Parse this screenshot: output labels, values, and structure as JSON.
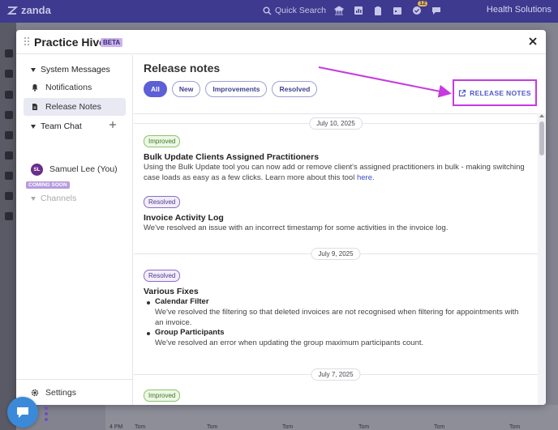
{
  "topbar": {
    "logo_text": "zanda",
    "search_placeholder": "Quick Search",
    "notification_count": "12",
    "account_name": "Health Solutions",
    "bg_color": "#3d3a8f"
  },
  "modal": {
    "title": "Practice Hive",
    "beta_label": "BETA",
    "close_icon": "close-icon"
  },
  "sidebar": {
    "system_messages": "System Messages",
    "notifications": "Notifications",
    "release_notes": "Release Notes",
    "team_chat": "Team Chat",
    "user_initials": "SL",
    "user_name": "Samuel Lee (You)",
    "coming_soon": "COMING SOON",
    "channels": "Channels",
    "settings": "Settings"
  },
  "content": {
    "title": "Release notes",
    "filters": [
      "All",
      "New",
      "Improvements",
      "Resolved"
    ],
    "active_filter": "All",
    "release_notes_button": "RELEASE NOTES",
    "accent_color": "#5c5fd6",
    "highlight_color": "#c63ae0"
  },
  "feed": [
    {
      "date": "July 10, 2025",
      "entries": [
        {
          "tag": "Improved",
          "title": "Bulk Update Clients Assigned Practitioners",
          "body_line1": "Using the Bulk Update tool you can now add or remove client's assigned practitioners in bulk - making switching",
          "body_line2": "case loads as easy as a few clicks. Learn more about this tool ",
          "link": "here",
          "link_suffix": "."
        },
        {
          "tag": "Resolved",
          "title": "Invoice Activity Log",
          "body": "We've resolved an issue with an incorrect timestamp for some activities in the invoice log."
        }
      ]
    },
    {
      "date": "July 9, 2025",
      "entries": [
        {
          "tag": "Resolved",
          "title": "Various Fixes",
          "items": [
            {
              "heading": "Calendar Filter",
              "text_line1": "We've resolved the filtering so that deleted invoices are not recognised when filtering for appointments with",
              "text_line2": "an invoice."
            },
            {
              "heading": "Group Participants",
              "text_line1": "We've resolved an error when updating the group maximum participants count."
            }
          ]
        }
      ]
    },
    {
      "date": "July 7, 2025",
      "entries": [
        {
          "tag": "Improved"
        }
      ]
    }
  ],
  "background_calendar": {
    "time_label": "4 PM",
    "event_labels": [
      "Tom",
      "Tom",
      "Tom",
      "Tom",
      "Tom",
      "Tom"
    ]
  }
}
